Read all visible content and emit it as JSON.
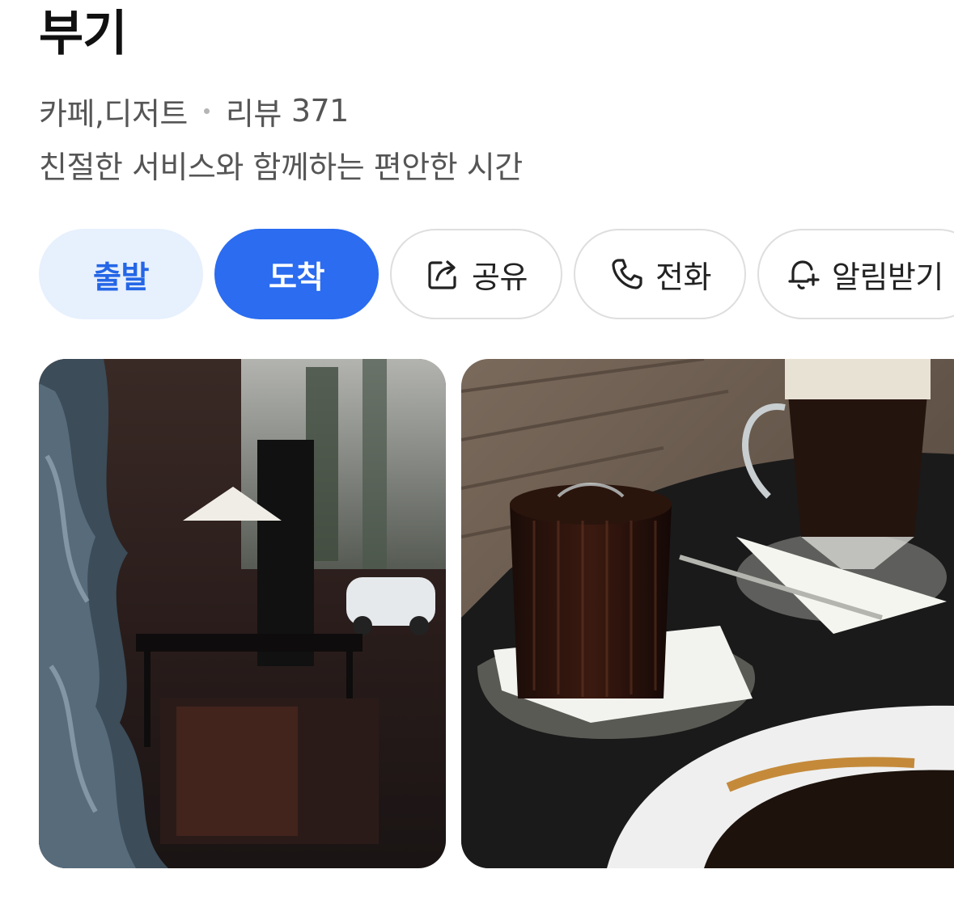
{
  "place": {
    "name": "부기",
    "category": "카페,디저트",
    "review_label": "리뷰",
    "review_count": "371",
    "description": "친절한 서비스와 함께하는 편안한 시간"
  },
  "actions": {
    "depart_label": "출발",
    "arrive_label": "도착",
    "share_label": "공유",
    "call_label": "전화",
    "alarm_label": "알림받기",
    "share_icon": "share-icon",
    "call_icon": "phone-icon",
    "alarm_icon": "bell-plus-icon"
  },
  "colors": {
    "primary": "#2b6cf0",
    "primary_light": "#e7f0fd",
    "text_secondary": "#555555",
    "border": "#dedede"
  }
}
